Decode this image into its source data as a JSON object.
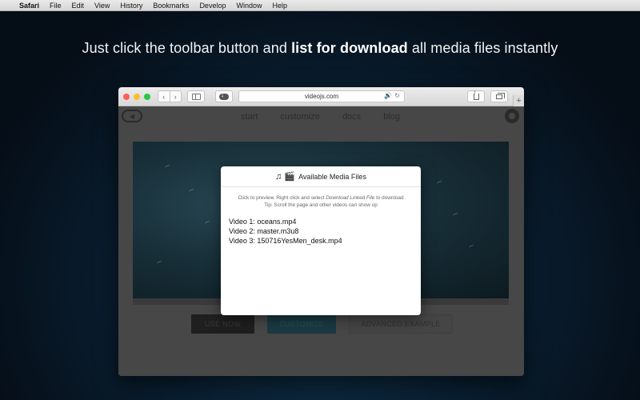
{
  "menubar": {
    "app_name": "Safari",
    "items": [
      "File",
      "Edit",
      "View",
      "History",
      "Bookmarks",
      "Develop",
      "Window",
      "Help"
    ]
  },
  "headline": {
    "before": "Just click the toolbar button and ",
    "bold": "list for download",
    "after": " all media files instantly"
  },
  "browser": {
    "url": "videojs.com",
    "nav_back": "‹",
    "nav_forward": "›",
    "new_tab": "+",
    "speaker_glyph": "🔊",
    "reload_glyph": "↻"
  },
  "site": {
    "logo_glyph": "◀",
    "nav": [
      "start",
      "customize",
      "docs",
      "blog"
    ],
    "buttons": {
      "use_now": "USE NOW",
      "customize": "CUSTOMIZE",
      "advanced": "ADVANCED EXAMPLE"
    }
  },
  "popup": {
    "icons": "♫ 🎬",
    "title": "Available Media Files",
    "tip_line1_prefix": "Click to preview. Right click and select ",
    "tip_line1_italic": "Download Linked File",
    "tip_line1_suffix": " to download",
    "tip_line2": "Tip: Scroll the page and other videos can show up",
    "files": [
      "Video 1: oceans.mp4",
      "Video 2: master.m3u8",
      "Video 3: 150716YesMen_desk.mp4"
    ]
  },
  "colors": {
    "traffic_red": "#fc5f57",
    "traffic_yellow": "#fdbc2e",
    "traffic_green": "#28c840",
    "accent_blue": "#3a7bd5"
  }
}
